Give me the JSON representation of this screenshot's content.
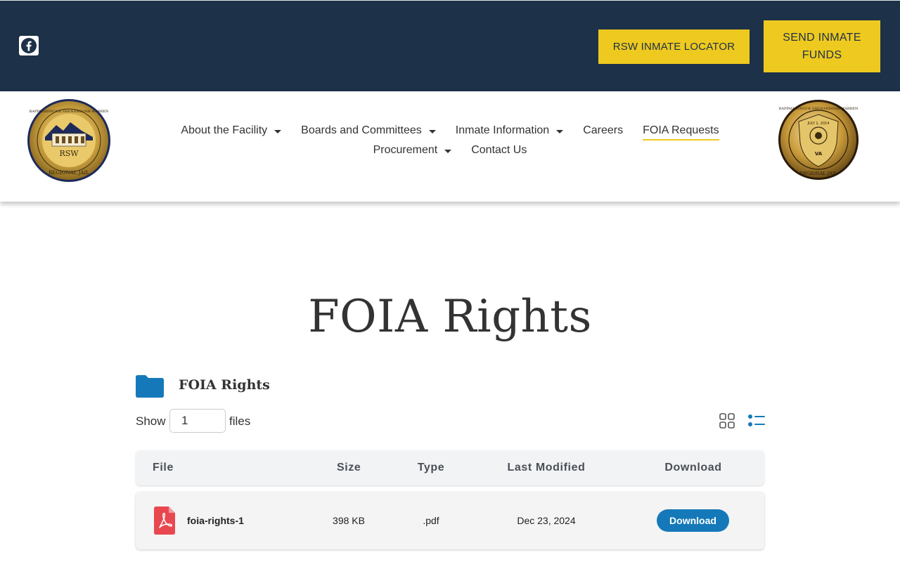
{
  "header": {
    "locator_label": "RSW INMATE LOCATOR",
    "funds_label": "SEND INMATE FUNDS",
    "colors": {
      "topbar": "#1d3148",
      "accent": "#eec91f"
    }
  },
  "nav": {
    "row1": [
      {
        "label": "About the Facility",
        "dropdown": true
      },
      {
        "label": "Boards and Committees",
        "dropdown": true
      },
      {
        "label": "Inmate Information",
        "dropdown": true
      },
      {
        "label": "Careers",
        "dropdown": false
      },
      {
        "label": "FOIA Requests",
        "dropdown": false,
        "active": true
      }
    ],
    "row2": [
      {
        "label": "Procurement",
        "dropdown": true
      },
      {
        "label": "Contact Us",
        "dropdown": false
      }
    ]
  },
  "logo_left": {
    "top": "RAPPAHANNOCK·SHENANDOAH·WARREN",
    "mid": "RSW",
    "bottom": "REGIONAL JAIL"
  },
  "logo_right": {
    "top": "RAPPAHANNOCK·SHENANDOAH·WARREN",
    "date": "JULY 1, 2014",
    "state": "VA",
    "bottom": "REGIONAL JAIL"
  },
  "page": {
    "title": "FOIA Rights"
  },
  "folder": {
    "name": "FOIA Rights",
    "color": "#1579b9"
  },
  "pagination": {
    "show_label": "Show",
    "value": "1",
    "files_label": "files"
  },
  "table": {
    "headers": {
      "file": "File",
      "size": "Size",
      "type": "Type",
      "modified": "Last Modified",
      "download": "Download"
    },
    "rows": [
      {
        "name": "foia-rights-1",
        "size": "398 KB",
        "type": ".pdf",
        "modified": "Dec 23, 2024",
        "download_label": "Download"
      }
    ]
  }
}
